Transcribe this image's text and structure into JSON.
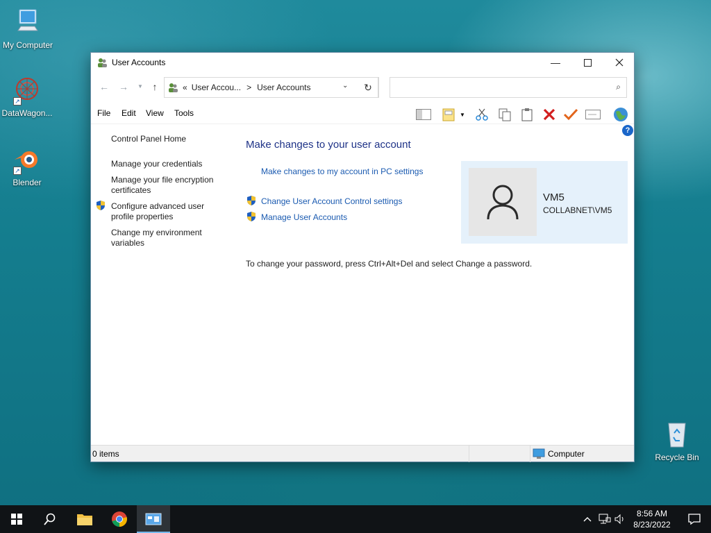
{
  "desktop": {
    "icons": [
      {
        "label": "My Computer"
      },
      {
        "label": "DataWagon..."
      },
      {
        "label": "Blender"
      },
      {
        "label": "Recycle Bin"
      }
    ]
  },
  "window": {
    "title": "User Accounts",
    "address": {
      "prefix": "«",
      "crumb1": "User Accou...",
      "separator": ">",
      "crumb2": "User Accounts"
    },
    "search": {
      "placeholder": ""
    },
    "menu": [
      "File",
      "Edit",
      "View",
      "Tools"
    ],
    "left_nav": {
      "home": "Control Panel Home",
      "credentials": "Manage your credentials",
      "encryption_line1": "Manage your file encryption",
      "encryption_line2": "certificates",
      "profile_line1": "Configure advanced user",
      "profile_line2": "profile properties",
      "env_line1": "Change my environment",
      "env_line2": "variables"
    },
    "main": {
      "heading": "Make changes to your user account",
      "pc_settings_link": "Make changes to my account in PC settings",
      "uac_link": "Change User Account Control settings",
      "manage_link": "Manage User Accounts",
      "password_note": "To change your password, press Ctrl+Alt+Del and select Change a password."
    },
    "user": {
      "name": "VM5",
      "domain": "COLLABNET\\VM5"
    },
    "help": "?",
    "status": {
      "items": "0 items",
      "location": "Computer"
    }
  },
  "taskbar": {
    "time": "8:56 AM",
    "date": "8/23/2022"
  },
  "colors": {
    "heading": "#1e3287",
    "link": "#1a5ab0",
    "user_panel": "#e5f1fb",
    "taskbar": "#101316"
  }
}
